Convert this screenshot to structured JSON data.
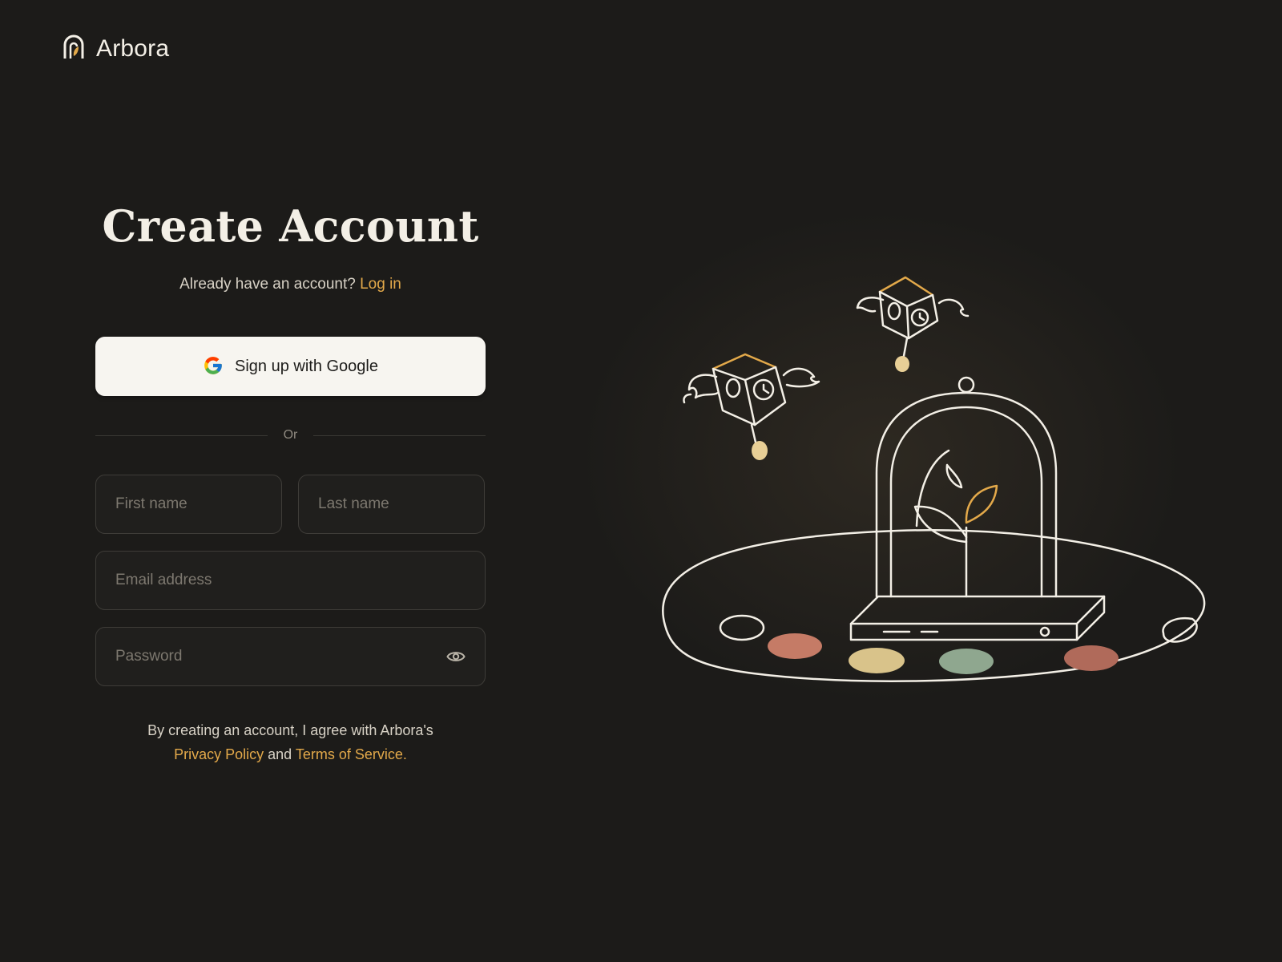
{
  "brand": {
    "name": "Arbora",
    "icon": "arch-leaf-logo-icon"
  },
  "form": {
    "title": "Create Account",
    "subtitle_prefix": "Already have an account?",
    "login_link": "Log in",
    "google_button_label": "Sign up with Google",
    "divider_text": "Or",
    "fields": {
      "first_name": {
        "placeholder": "First name",
        "value": ""
      },
      "last_name": {
        "placeholder": "Last name",
        "value": ""
      },
      "email": {
        "placeholder": "Email address",
        "value": ""
      },
      "password": {
        "placeholder": "Password",
        "value": ""
      }
    },
    "terms": {
      "prefix": "By creating an account, I agree with Arbora's",
      "privacy_link": "Privacy Policy",
      "connector": "and",
      "tos_link": "Terms of Service."
    }
  },
  "colors": {
    "background": "#1c1b19",
    "accent": "#e3a94a",
    "button_bg": "#f7f5f0",
    "field_border": "#3e3c38"
  }
}
